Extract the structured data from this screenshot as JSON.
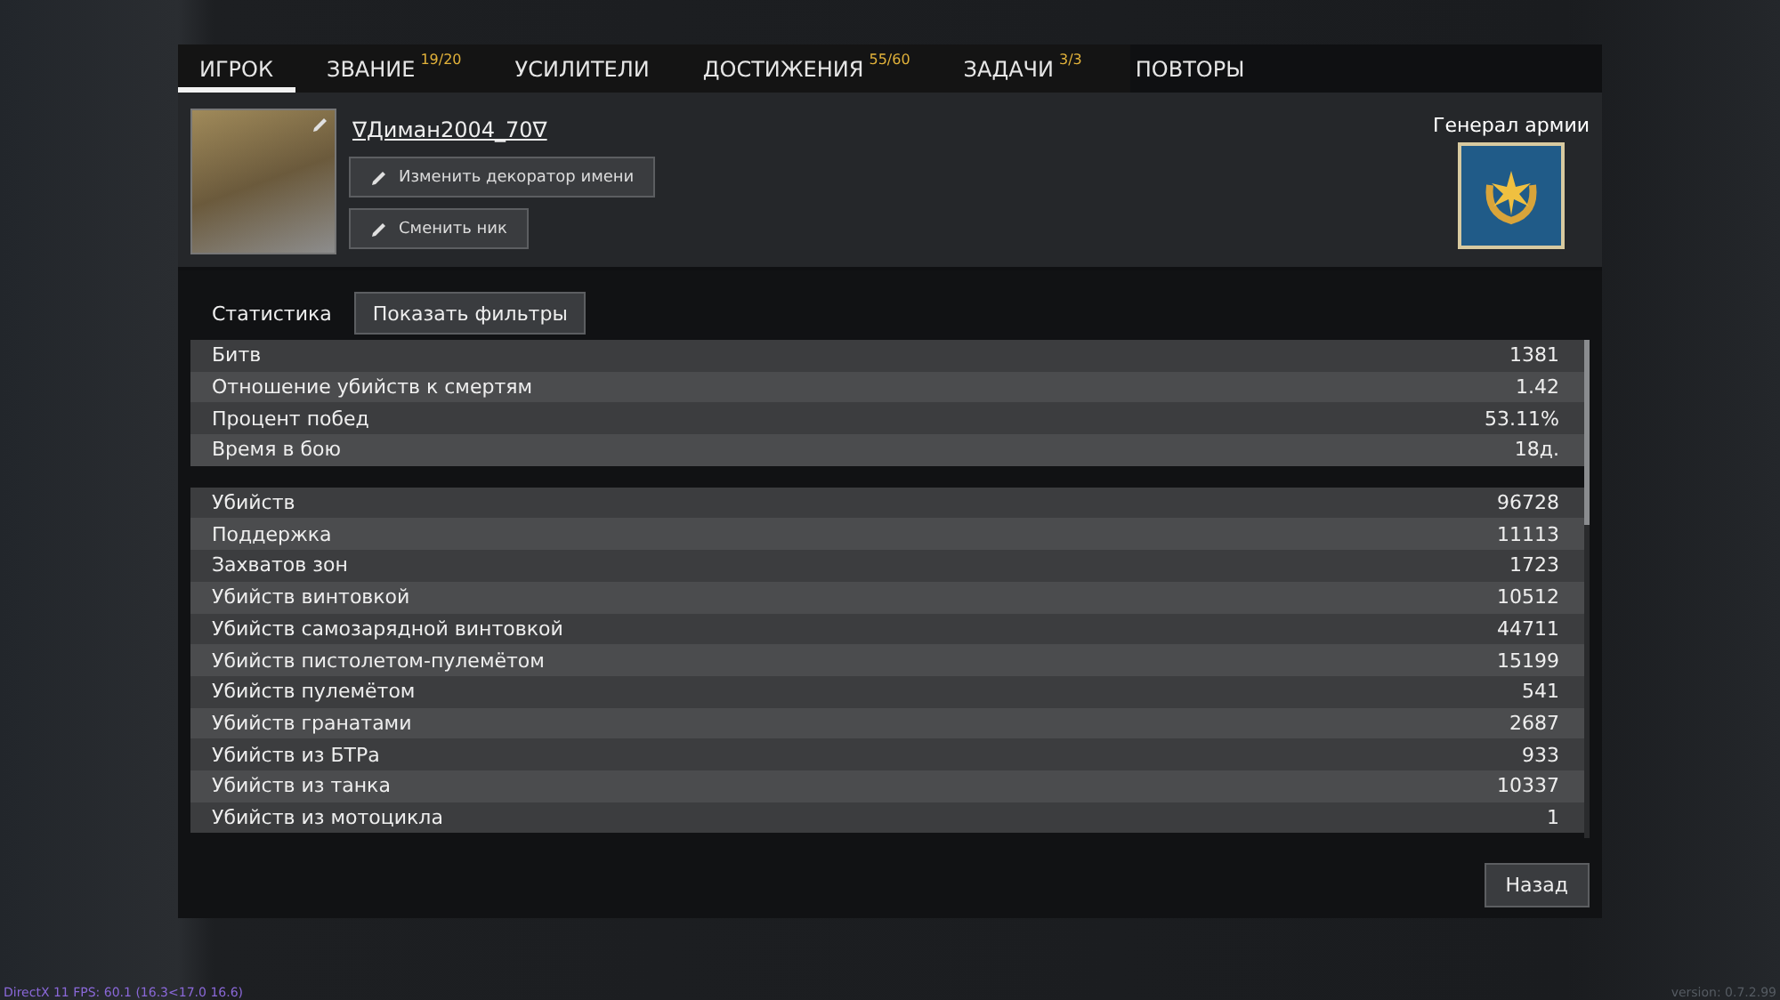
{
  "tabs": [
    {
      "label": "ИГРОК",
      "selected": true
    },
    {
      "label": "ЗВАНИЕ",
      "badge": "19/20",
      "selected": false
    },
    {
      "label": "УСИЛИТЕЛИ",
      "selected": false
    },
    {
      "label": "ДОСТИЖЕНИЯ",
      "badge": "55/60",
      "selected": false
    },
    {
      "label": "ЗАДАЧИ",
      "badge": "3/3",
      "selected": false
    },
    {
      "label": "ПОВТОРЫ",
      "selected": false
    }
  ],
  "player": {
    "name": "∇Диман2004_70∇",
    "buttons": [
      "Изменить декоратор имени",
      "Сменить ник"
    ]
  },
  "rank": {
    "title": "Генерал армии"
  },
  "stats": {
    "title": "Статистика",
    "filter_button": "Показать фильтры",
    "groups": [
      [
        {
          "label": "Битв",
          "value": "1381"
        },
        {
          "label": "Отношение убийств к смертям",
          "value": "1.42"
        },
        {
          "label": "Процент побед",
          "value": "53.11%"
        },
        {
          "label": "Время в бою",
          "value": "18д."
        }
      ],
      [
        {
          "label": "Убийств",
          "value": "96728"
        },
        {
          "label": "Поддержка",
          "value": "11113"
        },
        {
          "label": "Захватов зон",
          "value": "1723"
        },
        {
          "label": "Убийств винтовкой",
          "value": "10512"
        },
        {
          "label": "Убийств самозарядной винтовкой",
          "value": "44711"
        },
        {
          "label": "Убийств пистолетом-пулемётом",
          "value": "15199"
        },
        {
          "label": "Убийств пулемётом",
          "value": "541"
        },
        {
          "label": "Убийств гранатами",
          "value": "2687"
        },
        {
          "label": "Убийств из БТРа",
          "value": "933"
        },
        {
          "label": "Убийств из танка",
          "value": "10337"
        },
        {
          "label": "Убийств из мотоцикла",
          "value": "1"
        }
      ]
    ]
  },
  "back_button": "Назад",
  "footer": {
    "debug": "DirectX 11 FPS: 60.1 (16.3<17.0 16.6)",
    "version": "version: 0.7.2.99"
  }
}
